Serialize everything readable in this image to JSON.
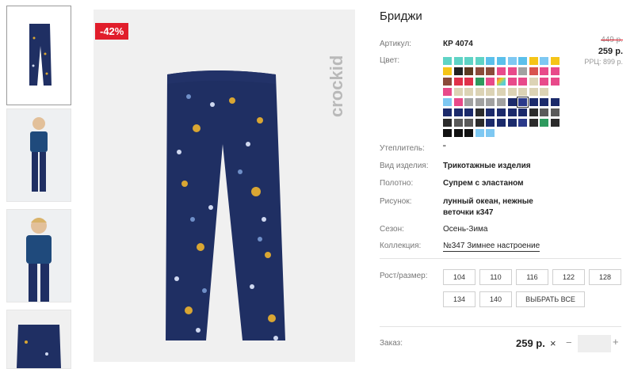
{
  "product": {
    "title": "Бриджи",
    "discount_badge": "-42%",
    "brand_logo": "crockid",
    "old_price": "449 р.",
    "price": "259 р.",
    "rrp": "РРЦ: 899 р."
  },
  "details": {
    "article_label": "Артикул:",
    "article_value": "КР 4074",
    "color_label": "Цвет:",
    "insulation_label": "Утеплитель:",
    "insulation_value": "\"",
    "type_label": "Вид изделия:",
    "type_value": "Трикотажные изделия",
    "fabric_label": "Полотно:",
    "fabric_value": "Супрем с эластаном",
    "print_label": "Рисунок:",
    "print_value_line1": "лунный океан, нежные",
    "print_value_line2": "веточки к347",
    "season_label": "Сезон:",
    "season_value": "Осень-Зима",
    "collection_label": "Коллекция:",
    "collection_value": "№347 Зимнее настроение"
  },
  "sizes": {
    "label": "Рост/размер:",
    "items": [
      "104",
      "110",
      "116",
      "122",
      "128",
      "134",
      "140"
    ],
    "select_all": "ВЫБРАТЬ ВСЕ"
  },
  "order": {
    "label": "Заказ:",
    "price": "259 р.",
    "remove_icon": "×",
    "minus_icon": "−",
    "plus_icon": "+"
  },
  "swatch_colors": [
    [
      "#5fd3c5",
      "#5fd3c5",
      "#5fd3c5",
      "#5fd3c5",
      "#5bc0eb",
      "#5bc0eb",
      "#7ec8f2",
      "#5bc0eb",
      "#f5c518",
      "#7ec8f2",
      "#f5c518"
    ],
    [
      "#f5c518",
      "#222222",
      "#5c3a21",
      "#8b4a3a",
      "#8b4a3a",
      "#e84a8a",
      "#e84a8a",
      "#a1a1a1",
      "#d9534f",
      "#e84a8a",
      "#e84a8a"
    ],
    [
      "#8b4a3a",
      "#e0314a",
      "#e0314a",
      "#2e9a5e",
      "#e84a8a",
      "#rainbow",
      "#e84a8a",
      "#e84a8a",
      "#dcd3b5",
      "#e84a8a",
      "#e84a8a"
    ],
    [
      "#e84a8a",
      "#dcd3b5",
      "#dcd3b5",
      "#dcd3b5",
      "#dcd3b5",
      "#dcd3b5",
      "#dcd3b5",
      "#dcd3b5",
      "#dcd3b5",
      "#dcd3b5",
      ""
    ],
    [
      "#7ec8f2",
      "#e84a8a",
      "#a1a1a1",
      "#a1a1a1",
      "#a1a1a1",
      "#a1a1a1",
      "#1b2a6b",
      "#2b3a8a",
      "#1b2a6b",
      "#1b2a6b",
      "#1b2a6b"
    ],
    [
      "#1b2a6b",
      "#1b2a6b",
      "#1b2a6b",
      "#2b2b2b",
      "#1b2a6b",
      "#1b2a6b",
      "#1b2a6b",
      "#1b2a6b",
      "#2b2b2b",
      "#5a5a5a",
      "#5a5a5a"
    ],
    [
      "#2b2b2b",
      "#5a5a5a",
      "#5a5a5a",
      "#2b2b2b",
      "#1b2a6b",
      "#1b2a6b",
      "#1b2a6b",
      "#2b3a8a",
      "#2b2b2b",
      "#2e9a5e",
      "#2b2b2b"
    ],
    [
      "#111111",
      "#111111",
      "#111111",
      "#7ec8f2",
      "#7ec8f2",
      "",
      "",
      "",
      "",
      "",
      ""
    ]
  ],
  "selected_swatch": [
    4,
    7
  ]
}
